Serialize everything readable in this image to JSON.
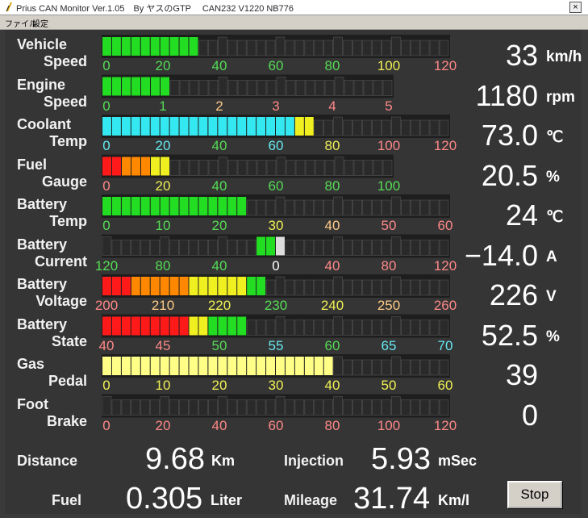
{
  "window": {
    "title": "Prius CAN Monitor Ver.1.05　By ヤスのGTP　 CAN232 V1220 NB776",
    "close_label": "×"
  },
  "menu": {
    "items": [
      "ファイル",
      "設定"
    ]
  },
  "colors": {
    "background": "#353535",
    "green": "#22dd22",
    "cyan": "#33e8f0",
    "yellow": "#f0f020",
    "orange": "#ff8800",
    "red": "#ff1a1a",
    "pale_yellow": "#ffff88",
    "gray_center": "#dddddd",
    "tick_green": "#55dd55",
    "tick_yellow": "#f0f055",
    "tick_red": "#ff8888",
    "tick_orange": "#ffcc88",
    "tick_cyan": "#66e8f0",
    "tick_white": "#ffffff"
  },
  "gauges": [
    {
      "label1": "Vehicle",
      "label2": "Speed",
      "value": "33",
      "unit": "km/h",
      "range": [
        0,
        120
      ],
      "level": 33,
      "segments": 36,
      "filled": 10,
      "fill_colors": [
        "green"
      ],
      "scale": [
        {
          "t": "0",
          "c": "tick_green"
        },
        {
          "t": "20",
          "c": "tick_green"
        },
        {
          "t": "40",
          "c": "tick_green"
        },
        {
          "t": "60",
          "c": "tick_green"
        },
        {
          "t": "80",
          "c": "tick_green"
        },
        {
          "t": "100",
          "c": "tick_yellow"
        },
        {
          "t": "120",
          "c": "tick_red"
        }
      ]
    },
    {
      "label1": "Engine",
      "label2": "Speed",
      "value": "1180",
      "unit": "rpm",
      "range": [
        0,
        5
      ],
      "level": 1.18,
      "segments": 30,
      "filled": 7,
      "fill_colors": [
        "green"
      ],
      "scale": [
        {
          "t": "0",
          "c": "tick_green"
        },
        {
          "t": "1",
          "c": "tick_green"
        },
        {
          "t": "2",
          "c": "tick_orange"
        },
        {
          "t": "3",
          "c": "tick_red"
        },
        {
          "t": "4",
          "c": "tick_red"
        },
        {
          "t": "5",
          "c": "tick_red"
        }
      ]
    },
    {
      "label1": "Coolant",
      "label2": "Temp",
      "value": "73.0",
      "unit": "℃",
      "range": [
        0,
        120
      ],
      "level": 73,
      "segments": 36,
      "filled": 22,
      "fill_colors": [
        "cyan",
        "cyan",
        "cyan",
        "cyan",
        "cyan",
        "cyan",
        "cyan",
        "cyan",
        "cyan",
        "cyan",
        "cyan",
        "cyan",
        "cyan",
        "cyan",
        "cyan",
        "cyan",
        "cyan",
        "cyan",
        "cyan",
        "cyan",
        "yellow",
        "yellow"
      ],
      "scale": [
        {
          "t": "0",
          "c": "tick_cyan"
        },
        {
          "t": "20",
          "c": "tick_cyan"
        },
        {
          "t": "40",
          "c": "tick_green"
        },
        {
          "t": "60",
          "c": "tick_cyan"
        },
        {
          "t": "80",
          "c": "tick_yellow"
        },
        {
          "t": "100",
          "c": "tick_red"
        },
        {
          "t": "120",
          "c": "tick_red"
        }
      ]
    },
    {
      "label1": "Fuel",
      "label2": "Gauge",
      "value": "20.5",
      "unit": "%",
      "range": [
        0,
        100
      ],
      "level": 20.5,
      "segments": 30,
      "filled": 7,
      "fill_colors": [
        "red",
        "red",
        "orange",
        "orange",
        "orange",
        "yellow",
        "yellow"
      ],
      "scale": [
        {
          "t": "0",
          "c": "tick_red"
        },
        {
          "t": "20",
          "c": "tick_yellow"
        },
        {
          "t": "40",
          "c": "tick_green"
        },
        {
          "t": "60",
          "c": "tick_green"
        },
        {
          "t": "80",
          "c": "tick_green"
        },
        {
          "t": "100",
          "c": "tick_green"
        }
      ]
    },
    {
      "label1": "Battery",
      "label2": "Temp",
      "value": "24",
      "unit": "℃",
      "range": [
        0,
        60
      ],
      "level": 24,
      "segments": 36,
      "filled": 15,
      "fill_colors": [
        "green"
      ],
      "scale": [
        {
          "t": "0",
          "c": "tick_green"
        },
        {
          "t": "10",
          "c": "tick_green"
        },
        {
          "t": "20",
          "c": "tick_green"
        },
        {
          "t": "30",
          "c": "tick_yellow"
        },
        {
          "t": "40",
          "c": "tick_orange"
        },
        {
          "t": "50",
          "c": "tick_red"
        },
        {
          "t": "60",
          "c": "tick_red"
        }
      ]
    },
    {
      "label1": "Battery",
      "label2": "Current",
      "value": "−14.0",
      "unit": "A",
      "range": [
        -120,
        120
      ],
      "level": -14,
      "segments": 36,
      "filled_from": 16,
      "filled_to": 18,
      "fill_colors": [
        "green"
      ],
      "scale": [
        {
          "t": "120",
          "c": "tick_green"
        },
        {
          "t": "80",
          "c": "tick_green"
        },
        {
          "t": "40",
          "c": "tick_green"
        },
        {
          "t": "0",
          "c": "tick_white"
        },
        {
          "t": "40",
          "c": "tick_red"
        },
        {
          "t": "80",
          "c": "tick_red"
        },
        {
          "t": "120",
          "c": "tick_red"
        }
      ]
    },
    {
      "label1": "Battery",
      "label2": "Voltage",
      "value": "226",
      "unit": "V",
      "range": [
        200,
        260
      ],
      "level": 226,
      "segments": 36,
      "filled": 17,
      "fill_colors": [
        "red",
        "red",
        "red",
        "orange",
        "orange",
        "orange",
        "orange",
        "orange",
        "orange",
        "yellow",
        "yellow",
        "yellow",
        "yellow",
        "yellow",
        "yellow",
        "green",
        "green"
      ],
      "scale": [
        {
          "t": "200",
          "c": "tick_red"
        },
        {
          "t": "210",
          "c": "tick_orange"
        },
        {
          "t": "220",
          "c": "tick_yellow"
        },
        {
          "t": "230",
          "c": "tick_green"
        },
        {
          "t": "240",
          "c": "tick_yellow"
        },
        {
          "t": "250",
          "c": "tick_orange"
        },
        {
          "t": "260",
          "c": "tick_red"
        }
      ]
    },
    {
      "label1": "Battery",
      "label2": "State",
      "value": "52.5",
      "unit": "%",
      "range": [
        40,
        70
      ],
      "level": 52.5,
      "segments": 36,
      "filled": 15,
      "fill_colors": [
        "red",
        "red",
        "red",
        "red",
        "red",
        "red",
        "red",
        "red",
        "red",
        "yellow",
        "yellow",
        "green",
        "green",
        "green",
        "green"
      ],
      "scale": [
        {
          "t": "40",
          "c": "tick_red"
        },
        {
          "t": "45",
          "c": "tick_red"
        },
        {
          "t": "50",
          "c": "tick_green"
        },
        {
          "t": "55",
          "c": "tick_cyan"
        },
        {
          "t": "60",
          "c": "tick_green"
        },
        {
          "t": "65",
          "c": "tick_cyan"
        },
        {
          "t": "70",
          "c": "tick_cyan"
        }
      ]
    },
    {
      "label1": "Gas",
      "label2": "Pedal",
      "value": "39",
      "unit": "",
      "range": [
        0,
        60
      ],
      "level": 39,
      "segments": 36,
      "filled": 24,
      "fill_colors": [
        "pale_yellow"
      ],
      "scale": [
        {
          "t": "0",
          "c": "tick_yellow"
        },
        {
          "t": "10",
          "c": "tick_yellow"
        },
        {
          "t": "20",
          "c": "tick_yellow"
        },
        {
          "t": "30",
          "c": "tick_yellow"
        },
        {
          "t": "40",
          "c": "tick_yellow"
        },
        {
          "t": "50",
          "c": "tick_yellow"
        },
        {
          "t": "60",
          "c": "tick_yellow"
        }
      ]
    },
    {
      "label1": "Foot",
      "label2": "Brake",
      "value": "0",
      "unit": "",
      "range": [
        0,
        120
      ],
      "level": 0,
      "segments": 36,
      "filled": 0,
      "fill_colors": [
        "green"
      ],
      "scale": [
        {
          "t": "0",
          "c": "tick_red"
        },
        {
          "t": "20",
          "c": "tick_red"
        },
        {
          "t": "40",
          "c": "tick_red"
        },
        {
          "t": "60",
          "c": "tick_red"
        },
        {
          "t": "80",
          "c": "tick_red"
        },
        {
          "t": "100",
          "c": "tick_red"
        },
        {
          "t": "120",
          "c": "tick_red"
        }
      ]
    }
  ],
  "summary": {
    "distance": {
      "label": "Distance",
      "value": "9.68",
      "unit": "Km"
    },
    "injection": {
      "label": "Injection",
      "value": "5.93",
      "unit": "mSec"
    },
    "fuel": {
      "label": "Fuel",
      "value": "0.305",
      "unit": "Liter"
    },
    "mileage": {
      "label": "Mileage",
      "value": "31.74",
      "unit": "Km/l"
    }
  },
  "stop_button": {
    "label": "Stop"
  }
}
